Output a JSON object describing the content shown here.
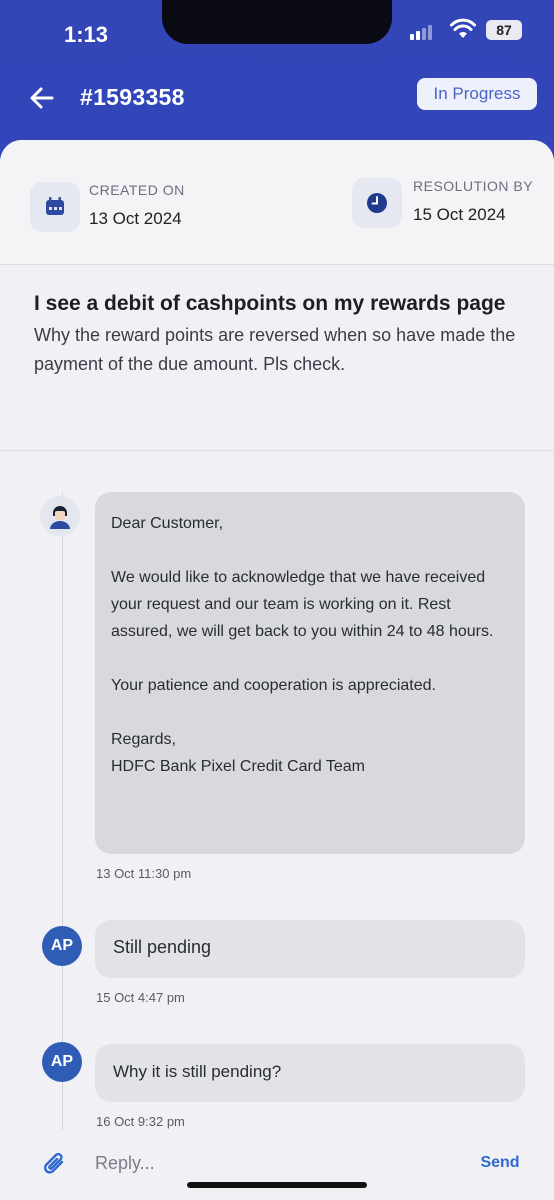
{
  "status_bar": {
    "time": "1:13",
    "battery": "87"
  },
  "header": {
    "ticket_id": "#1593358",
    "status": "In Progress"
  },
  "dates": {
    "created_label": "CREATED ON",
    "created_value": "13 Oct 2024",
    "resolution_label": "RESOLUTION BY",
    "resolution_value": "15 Oct 2024"
  },
  "issue": {
    "title": "I see a debit of cashpoints on my rewards page",
    "description": "Why the reward points are reversed when so have made the payment of the due amount. Pls check."
  },
  "messages": [
    {
      "sender": "agent",
      "greeting": "Dear Customer,",
      "body": "We would like to acknowledge that we have received your request and our team is working on it. Rest assured, we will get back to you within 24 to 48 hours.",
      "closing": "Your patience and cooperation is appreciated.",
      "regards": "Regards,",
      "signature": "HDFC Bank Pixel Credit Card Team",
      "timestamp": "13 Oct 11:30 pm"
    },
    {
      "sender": "user",
      "initials": "AP",
      "text": "Still pending",
      "timestamp": "15 Oct 4:47 pm"
    },
    {
      "sender": "user",
      "initials": "AP",
      "text": "Why it is still pending?",
      "timestamp": "16 Oct 9:32 pm"
    }
  ],
  "reply": {
    "placeholder": "Reply...",
    "send_label": "Send"
  },
  "colors": {
    "header_bg": "#2f45bd",
    "accent": "#2f6ad1",
    "user_avatar": "#2f5db6"
  }
}
